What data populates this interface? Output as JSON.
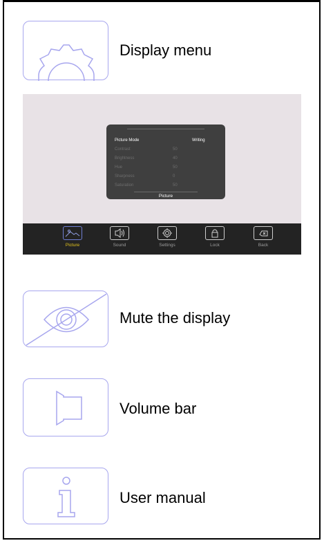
{
  "items": [
    {
      "label": "Display menu",
      "icon": "gear-icon"
    },
    {
      "label": "Mute the display",
      "icon": "eye-off-icon"
    },
    {
      "label": "Volume bar",
      "icon": "speaker-icon"
    },
    {
      "label": "User manual",
      "icon": "info-icon"
    }
  ],
  "tv_screen": {
    "osd": {
      "rows": [
        {
          "name": "Picture Mode",
          "value": "Writing"
        },
        {
          "name": "Contrast",
          "value": "50"
        },
        {
          "name": "Brightness",
          "value": "40"
        },
        {
          "name": "Hue",
          "value": "50"
        },
        {
          "name": "Sharpness",
          "value": "0"
        },
        {
          "name": "Saturation",
          "value": "50"
        }
      ],
      "title": "Picture"
    },
    "tabs": [
      {
        "label": "Picture",
        "icon": "image-icon",
        "active": true
      },
      {
        "label": "Sound",
        "icon": "speaker-icon",
        "active": false
      },
      {
        "label": "Settings",
        "icon": "gear-icon",
        "active": false
      },
      {
        "label": "Lock",
        "icon": "lock-icon",
        "active": false
      },
      {
        "label": "Back",
        "icon": "back-icon",
        "active": false
      }
    ]
  },
  "colors": {
    "icon_outline": "#a7a6ee",
    "active_tab_label": "#e6c51e",
    "osd_panel": "#3f3f3f",
    "tab_bar": "#232323"
  }
}
